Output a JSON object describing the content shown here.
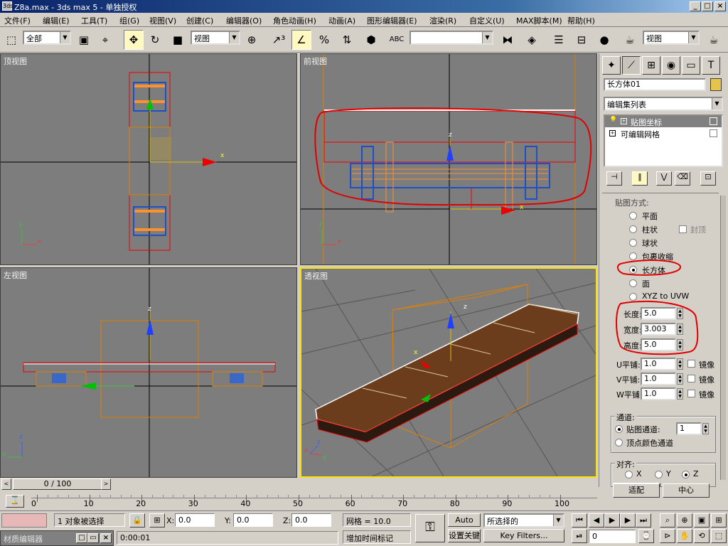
{
  "window": {
    "title": "Z8a.max - 3ds max 5 - 单独授权",
    "app_icon": "3ds"
  },
  "menu": [
    "文件(F)",
    "编辑(E)",
    "工具(T)",
    "组(G)",
    "视图(V)",
    "创建(C)",
    "编辑器(O)",
    "角色动画(H)",
    "动画(A)",
    "图形编辑器(E)",
    "渲染(R)",
    "自定义(U)",
    "MAX脚本(M)",
    "帮助(H)"
  ],
  "toolbar": {
    "selection_filter": "全部",
    "ref_coord": "视图",
    "named_selection": "",
    "ref_coord2": "视图",
    "abc_label": "ABC"
  },
  "viewports": {
    "top": {
      "label": "顶视图"
    },
    "front": {
      "label": "前视图"
    },
    "left": {
      "label": "左视图"
    },
    "perspective": {
      "label": "透视图"
    }
  },
  "axes": {
    "x": "x",
    "y": "y",
    "z": "z"
  },
  "command_panel": {
    "object_name": "长方体01",
    "object_color": "#e6c34a",
    "modifier_list_label": "编辑集列表",
    "stack": [
      "贴图坐标",
      "可编辑网格"
    ],
    "rollout_mapping": "贴图方式:",
    "mapping_types": [
      "平面",
      "柱状",
      "球状",
      "包裹收缩",
      "长方体",
      "面",
      "XYZ to UVW"
    ],
    "selected_mapping": "长方体",
    "cap_label": "封顶",
    "length_label": "长度:",
    "length_value": "5.0",
    "width_label": "宽度:",
    "width_value": "3.003",
    "height_label": "高度:",
    "height_value": "5.0",
    "u_tile_label": "U平铺:",
    "u_tile": "1.0",
    "v_tile_label": "V平铺:",
    "v_tile": "1.0",
    "w_tile_label": "W平铺:",
    "w_tile": "1.0",
    "mirror_label": "镜像",
    "channel_group": "通道:",
    "map_channel_label": "贴图通道:",
    "map_channel_value": "1",
    "vertex_color_label": "顶点颜色通道",
    "align_group": "对齐:",
    "align_axes": [
      "X",
      "Y",
      "Z"
    ],
    "align_selected": "Z",
    "fit_button": "适配",
    "center_button": "中心"
  },
  "timeline": {
    "frame_display": "0 / 100",
    "ticks": [
      "0",
      "10",
      "20",
      "30",
      "40",
      "50",
      "60",
      "70",
      "80",
      "90",
      "100"
    ],
    "progress": 0
  },
  "status": {
    "selection_info": "1 对象被选择",
    "x_label": "X:",
    "x_value": "0.0",
    "y_label": "Y:",
    "y_value": "0.0",
    "z_label": "Z:",
    "z_value": "0.0",
    "grid": "网格 = 10.0",
    "add_time_tag": "增加时间标记",
    "auto_key": "Auto Key",
    "set_key": "设置关键帧",
    "key_filter_select": "所选择的",
    "key_filters": "Key Filters...",
    "current_frame": "0",
    "time_display": "0:00:01",
    "material_editor_task": "材质编辑器"
  },
  "annotation_color": "#e00000"
}
